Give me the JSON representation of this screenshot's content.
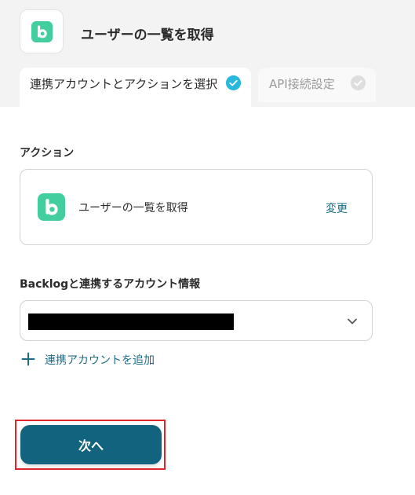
{
  "header": {
    "title": "ユーザーの一覧を取得",
    "app_icon": "backlog-logo",
    "brand_color": "#42ce9f"
  },
  "tabs": [
    {
      "label": "連携アカウントとアクションを選択",
      "completed": true,
      "active": true
    },
    {
      "label": "API接続設定",
      "completed": false,
      "active": false
    }
  ],
  "action_section": {
    "label": "アクション",
    "action_name": "ユーザーの一覧を取得",
    "change_label": "変更"
  },
  "account_section": {
    "label": "Backlogと連携するアカウント情報",
    "selected_value_redacted": true,
    "add_account_label": "連携アカウントを追加"
  },
  "footer": {
    "next_label": "次へ",
    "primary_color": "#12637e",
    "highlight_color": "#e0262b"
  }
}
